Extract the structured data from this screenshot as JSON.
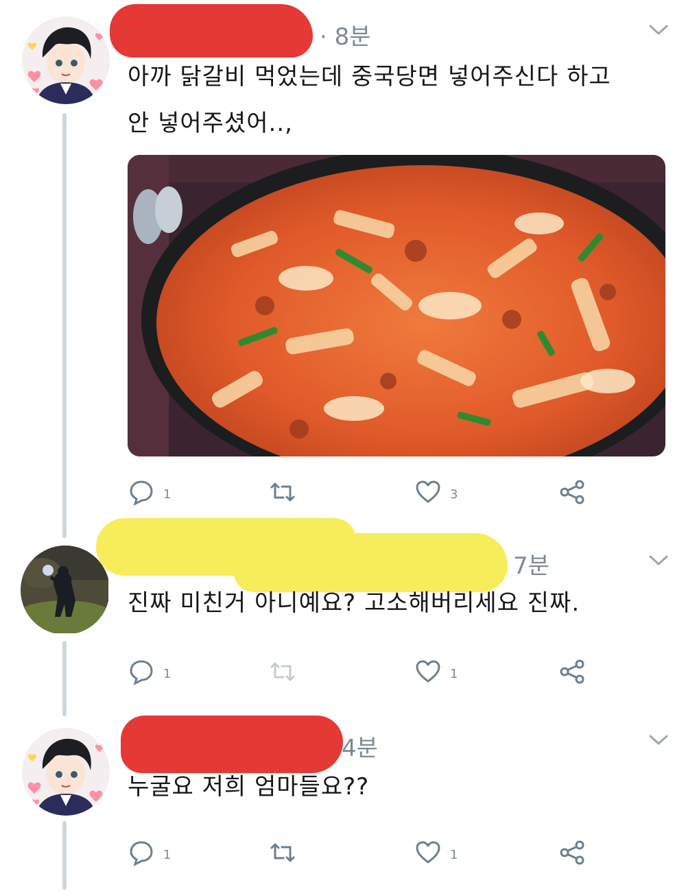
{
  "tweets": [
    {
      "time": "· 8분",
      "text_line1": "아까 닭갈비 먹었는데 중국당면 넣어주신다 하고",
      "text_line2": "안 넣어주셨어..,",
      "has_photo": true,
      "replies": "1",
      "retweets": "",
      "likes": "3"
    },
    {
      "time": "7분",
      "text_line1": "진짜 미친거 아니예요? 고소해버리세요 진짜.",
      "replies": "1",
      "retweets": "",
      "likes": "1"
    },
    {
      "time": "4분",
      "text_line1": "누굴요 저희 엄마들요??",
      "replies": "1",
      "retweets": "",
      "likes": "1"
    }
  ],
  "colors": {
    "redact_red": "#e53935",
    "redact_yellow": "#f7ec5a",
    "muted": "#7b8a97",
    "thread_line": "#ccd6dd"
  },
  "icons": [
    "reply-icon",
    "retweet-icon",
    "like-icon",
    "share-icon",
    "chevron-down-icon"
  ]
}
